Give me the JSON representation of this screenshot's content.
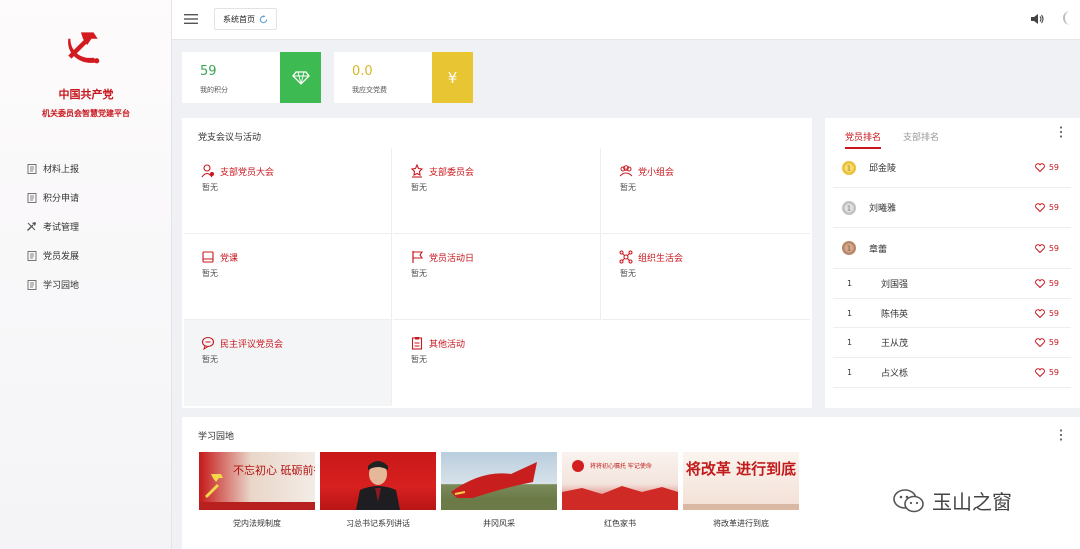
{
  "sidebar": {
    "brand_name": "中国共产党",
    "brand_sub": "机关委员会智慧党建平台",
    "items": [
      {
        "label": "材料上报",
        "icon": "document-icon"
      },
      {
        "label": "积分申请",
        "icon": "document-icon"
      },
      {
        "label": "考试管理",
        "icon": "tools-icon"
      },
      {
        "label": "党员发展",
        "icon": "document-icon"
      },
      {
        "label": "学习园地",
        "icon": "document-icon"
      }
    ]
  },
  "topbar": {
    "tab_label": "系统首页"
  },
  "stats": [
    {
      "value": "59",
      "label": "我的积分",
      "color": "#3dbb52",
      "value_color": "#3aa655",
      "icon": "diamond-icon"
    },
    {
      "value": "0.0",
      "label": "我应交党费",
      "color": "#e8c533",
      "value_color": "#d8b629",
      "icon": "yen-icon",
      "icon_glyph": "¥"
    }
  ],
  "meetings": {
    "title": "党支会议与活动",
    "items": [
      {
        "label": "支部党员大会",
        "status": "暂无",
        "icon": "people-icon"
      },
      {
        "label": "支部委员会",
        "status": "暂无",
        "icon": "star-person-icon"
      },
      {
        "label": "党小组会",
        "status": "暂无",
        "icon": "group-icon"
      },
      {
        "label": "党课",
        "status": "暂无",
        "icon": "book-icon"
      },
      {
        "label": "党员活动日",
        "status": "暂无",
        "icon": "flag-icon"
      },
      {
        "label": "组织生活会",
        "status": "暂无",
        "icon": "network-icon"
      },
      {
        "label": "民主评议党员会",
        "status": "暂无",
        "icon": "chat-icon"
      },
      {
        "label": "其他活动",
        "status": "暂无",
        "icon": "clipboard-icon"
      }
    ]
  },
  "ranking": {
    "tabs": [
      "党员排名",
      "支部排名"
    ],
    "rows": [
      {
        "rank": "1",
        "name": "邱金陵",
        "score": "59",
        "medal": "gold"
      },
      {
        "rank": "1",
        "name": "刘曦雅",
        "score": "59",
        "medal": "silver"
      },
      {
        "rank": "1",
        "name": "章蕾",
        "score": "59",
        "medal": "bronze"
      },
      {
        "rank": "1",
        "name": "刘国强",
        "score": "59"
      },
      {
        "rank": "1",
        "name": "陈伟英",
        "score": "59"
      },
      {
        "rank": "1",
        "name": "王从茂",
        "score": "59"
      },
      {
        "rank": "1",
        "name": "占义栎",
        "score": "59"
      }
    ]
  },
  "learning": {
    "title": "学习园地",
    "items": [
      {
        "caption": "党内法规制度",
        "art": "不忘初心 砥砺前行"
      },
      {
        "caption": "习总书记系列讲话",
        "art": ""
      },
      {
        "caption": "井冈风采",
        "art": ""
      },
      {
        "caption": "红色家书",
        "art": "将将初心嘱托 牢记使命"
      },
      {
        "caption": "将改革进行到底",
        "art": "将改革 进行到底"
      }
    ]
  },
  "watermark": {
    "text": "玉山之窗"
  },
  "colors": {
    "party_red": "#c8171e"
  }
}
